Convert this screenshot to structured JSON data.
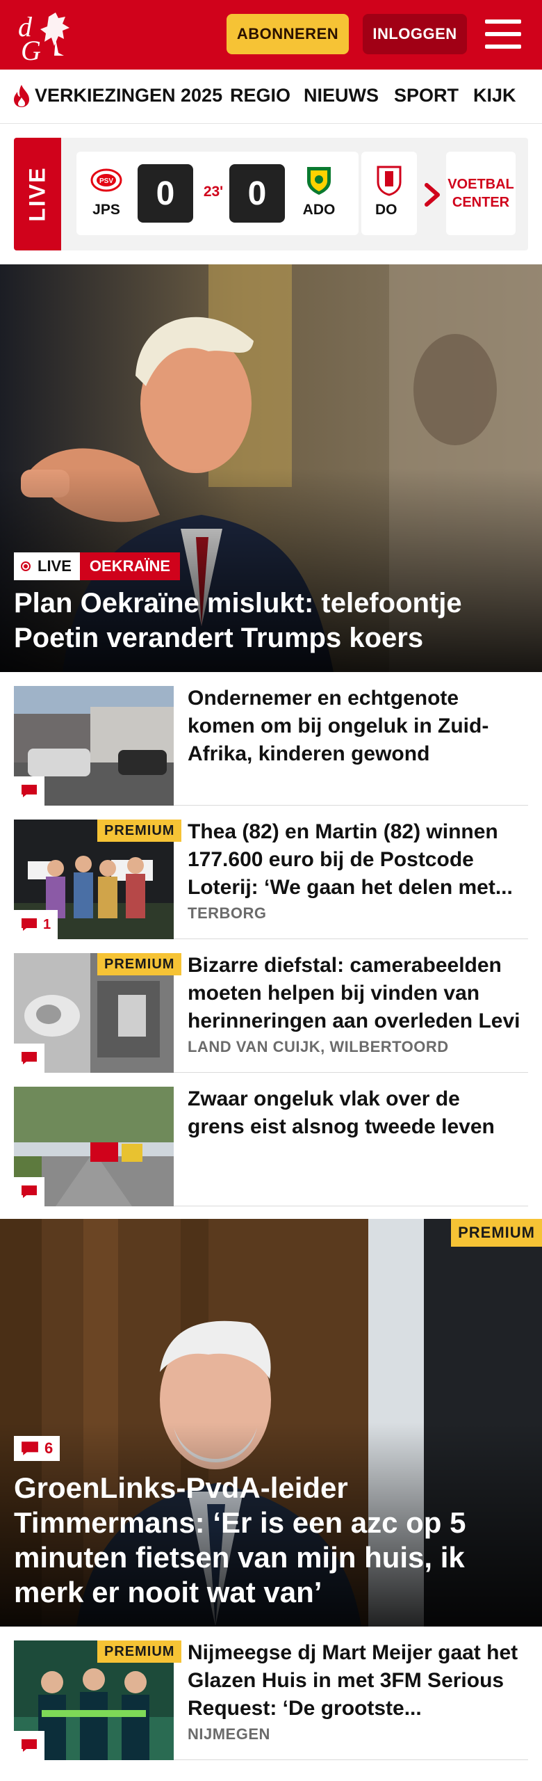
{
  "header": {
    "logo_text": "dG",
    "subscribe_label": "ABONNEREN",
    "login_label": "INLOGGEN"
  },
  "nav": {
    "items": [
      "VERKIEZINGEN 2025",
      "REGIO",
      "NIEUWS",
      "SPORT",
      "KIJK"
    ]
  },
  "live": {
    "label": "LIVE",
    "match": {
      "home_team": "JPS",
      "home_score": "0",
      "minute": "23'",
      "away_score": "0",
      "away_team": "ADO"
    },
    "next_team": "DO",
    "voetbal_center_label": "VOETBAL CENTER"
  },
  "hero": {
    "live_badge": "LIVE",
    "topic": "OEKRAÏNE",
    "title": "Plan Oekraïne mislukt: telefoontje Poetin verandert Trumps koers"
  },
  "articles": [
    {
      "title": "Ondernemer en echtgenote komen om bij ongeluk in Zuid-Afrika, kinderen gewond",
      "location": "",
      "premium": "",
      "comments": ""
    },
    {
      "title": "Thea (82) en Martin (82) winnen 177.600 euro bij de Postcode Loterij: ‘We gaan het delen met...",
      "location": "TERBORG",
      "premium": "PREMIUM",
      "comments": "1"
    },
    {
      "title": "Bizarre diefstal: camerabeelden moeten helpen bij vinden van herinneringen aan overleden Levi",
      "location": "LAND VAN CUIJK, WILBERTOORD",
      "premium": "PREMIUM",
      "comments": ""
    },
    {
      "title": "Zwaar ongeluk vlak over de grens eist alsnog tweede leven",
      "location": "",
      "premium": "",
      "comments": ""
    }
  ],
  "hero2": {
    "premium": "PREMIUM",
    "comments": "6",
    "title": "GroenLinks-PvdA-leider Timmermans: ‘Er is een azc op 5 minuten fietsen van mijn huis, ik merk er nooit wat van’"
  },
  "article5": {
    "title": "Nijmeegse dj Mart Meijer gaat het Glazen Huis in met 3FM Serious Request: ‘De grootste...",
    "location": "NIJMEGEN",
    "premium": "PREMIUM"
  },
  "colors": {
    "brand_red": "#d0021b",
    "dark_red": "#a10015",
    "premium_yellow": "#f6c335"
  }
}
